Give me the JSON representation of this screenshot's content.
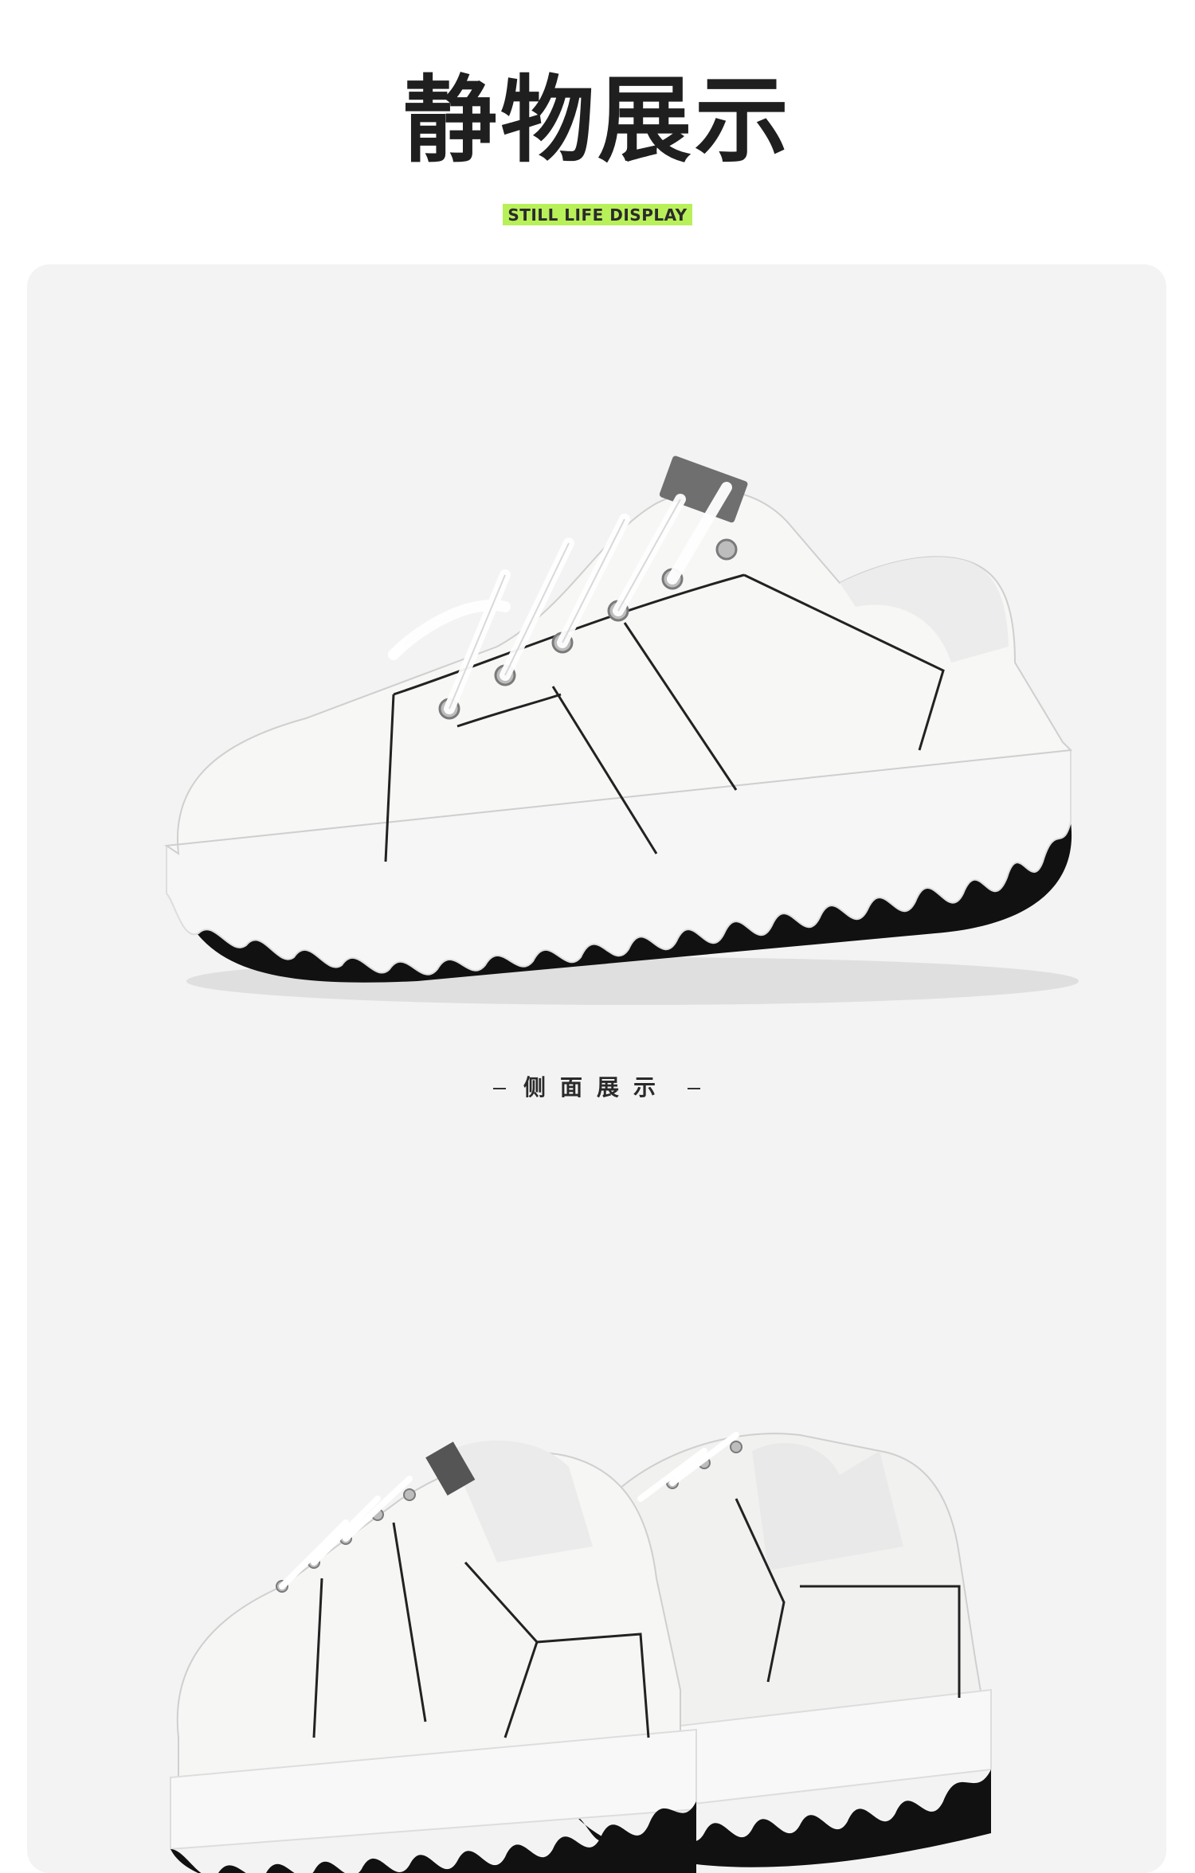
{
  "header": {
    "title": "静物展示",
    "subtitle": "STILL LIFE DISPLAY"
  },
  "sections": [
    {
      "caption": "侧面展示"
    }
  ],
  "colors": {
    "accent": "#b8f05a",
    "panel_bg": "#f3f3f3",
    "text_dark": "#1f1f1f"
  }
}
